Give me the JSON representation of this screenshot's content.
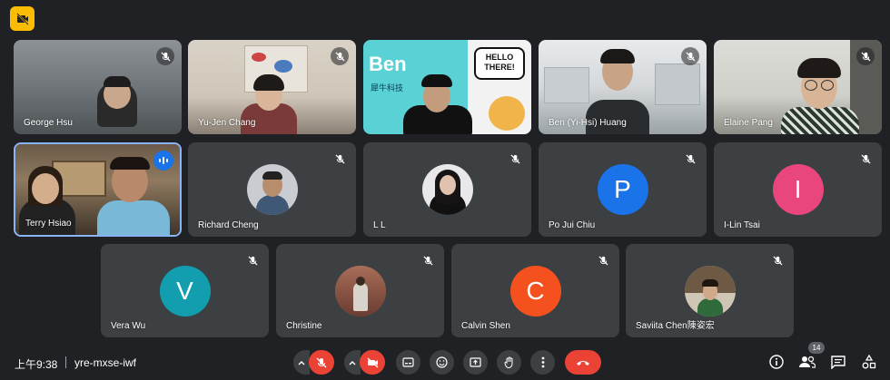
{
  "meeting": {
    "time": "上午9:38",
    "code": "yre-mxse-iwf",
    "participant_count": "14"
  },
  "participants": [
    {
      "name": "George Hsu"
    },
    {
      "name": "Yu-Jen Chang"
    },
    {
      "name": ""
    },
    {
      "name": "Ben (Yi-Hsi) Huang"
    },
    {
      "name": "Elaine Pang"
    },
    {
      "name": "Terry Hsiao"
    },
    {
      "name": "Richard Cheng"
    },
    {
      "name": "L L"
    },
    {
      "name": "Po Jui Chiu",
      "initial": "P",
      "color": "#1a73e8"
    },
    {
      "name": "I-Lin Tsai",
      "initial": "I",
      "color": "#e8467c"
    },
    {
      "name": "Vera Wu",
      "initial": "V",
      "color": "#129eaf"
    },
    {
      "name": "Christine"
    },
    {
      "name": "Calvin Shen",
      "initial": "C",
      "color": "#f4511e"
    },
    {
      "name": "Saviita Chen陳姿宏"
    }
  ],
  "presentation": {
    "logo_text": "Ben",
    "company_text": "犀牛科技",
    "bubble_text": "HELLO THERE!"
  },
  "colors": {
    "background": "#202124",
    "tile": "#3c4043",
    "end_call": "#ea4335",
    "active_border": "#8ab4f8"
  }
}
